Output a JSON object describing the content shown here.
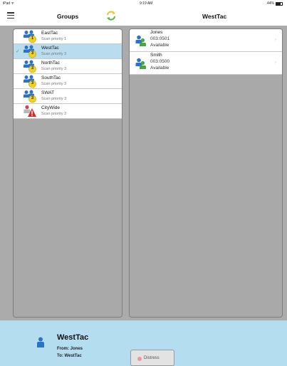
{
  "status_bar": {
    "device": "iPad ᯤ",
    "time": "9:19 AM",
    "battery": "44%"
  },
  "left_header": {
    "title": "Groups",
    "menu_icon": "hamburger-icon",
    "refresh_icon": "refresh-icon"
  },
  "right_header": {
    "title": "WestTac"
  },
  "groups": [
    {
      "name": "EastTac",
      "priority": "Scan priority 1",
      "badge": "1",
      "selected": false,
      "icon": "group-badge-icon"
    },
    {
      "name": "WestTac",
      "priority": "Scan priority 3",
      "badge": "3",
      "selected": true,
      "icon": "group-badge-icon"
    },
    {
      "name": "NorthTac",
      "priority": "Scan priority 3",
      "badge": "3",
      "selected": false,
      "icon": "group-badge-icon"
    },
    {
      "name": "SouthTac",
      "priority": "Scan priority 3",
      "badge": "3",
      "selected": false,
      "icon": "group-badge-icon"
    },
    {
      "name": "SWAT",
      "priority": "Scan priority 3",
      "badge": "3",
      "selected": false,
      "icon": "group-badge-icon"
    },
    {
      "name": "CityWide",
      "priority": "Scan priority 2",
      "badge": "!",
      "selected": false,
      "icon": "alert-group-icon"
    }
  ],
  "selected_check": "✓",
  "members": [
    {
      "name": "Jones",
      "id": "003:0501",
      "status": "Available"
    },
    {
      "name": "Smith",
      "id": "003:0500",
      "status": "Available"
    }
  ],
  "member_chevron": "›",
  "bottom_bar": {
    "group": "WestTac",
    "from": "From: Jones",
    "to": "To: WestTac",
    "distress_label": "Distress"
  },
  "colors": {
    "selected_row": "#b9dcef",
    "bottom_bar": "#b5ddf0",
    "pane_gray": "#ababab",
    "badge_yellow": "#f3d21c",
    "alert_red": "#d42a2a",
    "person_blue": "#2a73c7",
    "person_green": "#4aa63b"
  }
}
